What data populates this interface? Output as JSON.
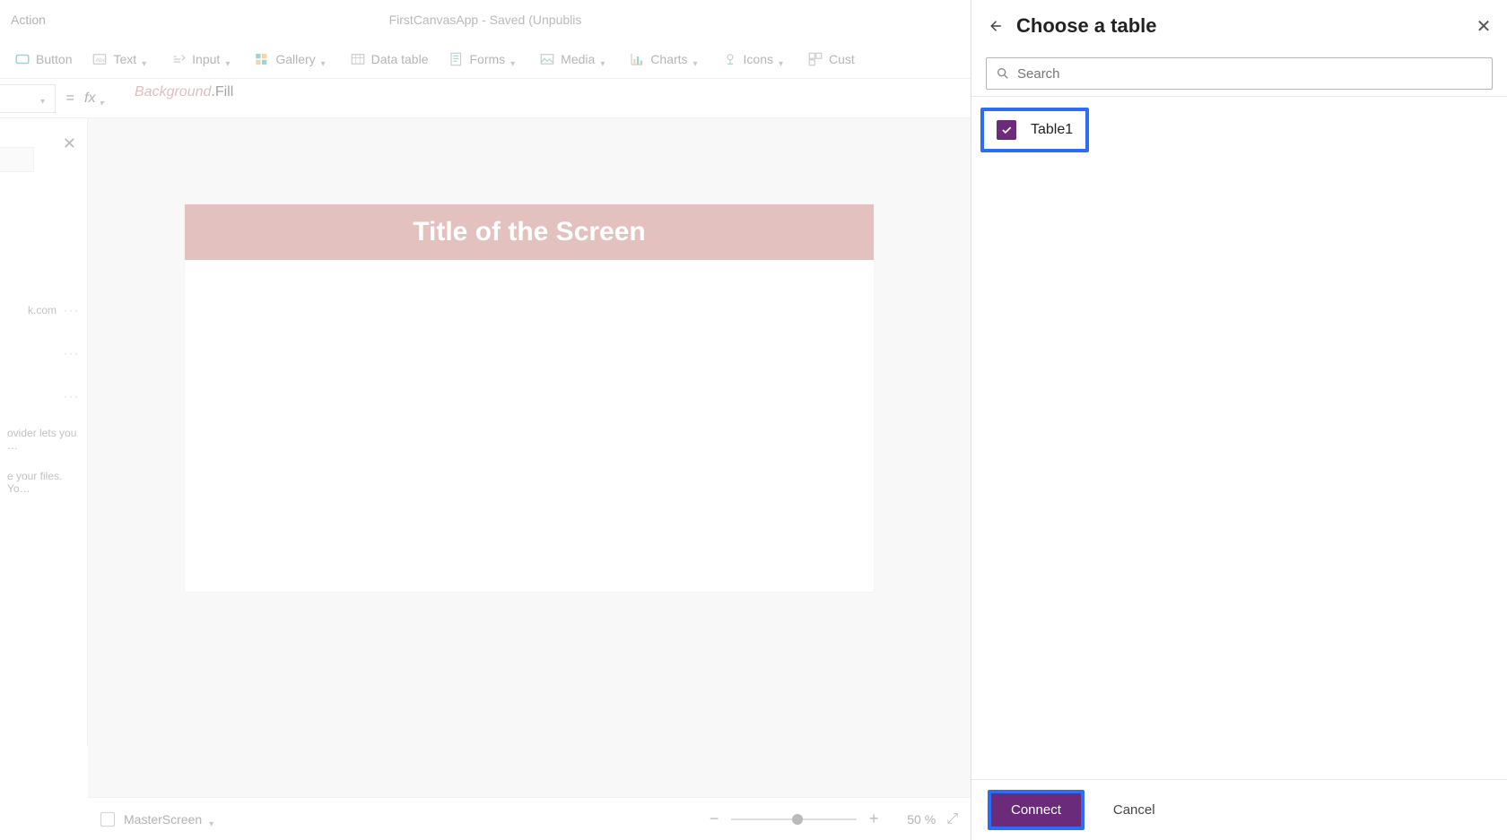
{
  "titleBar": {
    "tabAction": "Action",
    "appTitle": "FirstCanvasApp - Saved (Unpublis"
  },
  "ribbon": {
    "button": "Button",
    "text": "Text",
    "input": "Input",
    "gallery": "Gallery",
    "dataTable": "Data table",
    "forms": "Forms",
    "media": "Media",
    "charts": "Charts",
    "icons": "Icons",
    "custom": "Cust"
  },
  "formula": {
    "eq": "=",
    "fx": "fx",
    "token1": "Background",
    "token2": ".Fill"
  },
  "leftPane": {
    "row1": "k.com",
    "row3": "ovider lets you …",
    "row4": "e your files. Yo…"
  },
  "canvas": {
    "titleText": "Title of the Screen"
  },
  "statusBar": {
    "screenName": "MasterScreen",
    "zoomValue": "50",
    "zoomUnit": "%"
  },
  "sidePanel": {
    "title": "Choose a table",
    "searchPlaceholder": "Search",
    "tables": [
      {
        "name": "Table1",
        "checked": true
      }
    ],
    "connectLabel": "Connect",
    "cancelLabel": "Cancel"
  },
  "colors": {
    "accentPurple": "#6b2a7a",
    "highlightBlue": "#2d6df6",
    "headerBand": "#c07670"
  }
}
